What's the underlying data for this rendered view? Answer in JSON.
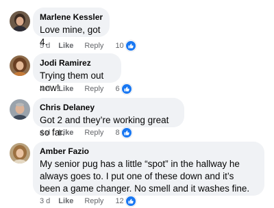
{
  "colors": {
    "bubble": "#f0f2f5",
    "meta_text": "#65676b",
    "like_blue": "#1877f2"
  },
  "comments": [
    {
      "author": "Marlene Kessler",
      "text": "Love mine, got 4.",
      "time": "5 d",
      "like_label": "Like",
      "reply_label": "Reply",
      "reaction_count": "10",
      "reaction_icon": "thumbs-up-icon"
    },
    {
      "author": "Jodi Ramirez",
      "text": "Trying them out now!",
      "time": "4 d",
      "like_label": "Like",
      "reply_label": "Reply",
      "reaction_count": "6",
      "reaction_icon": "thumbs-up-icon"
    },
    {
      "author": "Chris Delaney",
      "text": "Got 2 and they’re working great so far.",
      "time": "4 d",
      "like_label": "Like",
      "reply_label": "Reply",
      "reaction_count": "8",
      "reaction_icon": "thumbs-up-icon"
    },
    {
      "author": "Amber Fazio",
      "text": "My senior pug has a little “spot” in the hallway he always goes to. I put one of these down and it’s been a game changer. No smell and it washes fine.",
      "time": "3 d",
      "like_label": "Like",
      "reply_label": "Reply",
      "reaction_count": "12",
      "reaction_icon": "thumbs-up-icon"
    }
  ]
}
